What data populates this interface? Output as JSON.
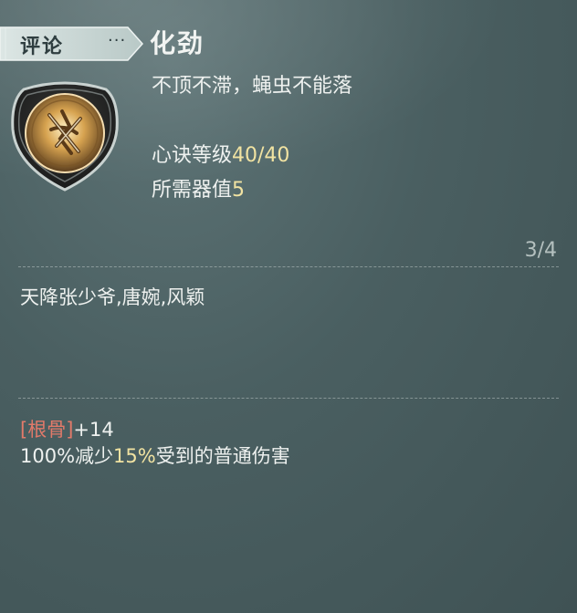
{
  "tab": {
    "review_label": "评论",
    "more_label": "···"
  },
  "skill": {
    "name": "化劲",
    "description": "不顶不滞，蝇虫不能落",
    "level_label": "心诀等级",
    "level_value": "40/40",
    "cost_label": "所需器值",
    "cost_value": "5"
  },
  "pagination": "3/4",
  "members": "天降张少爷,唐婉,风颖",
  "attribute": {
    "name": "[根骨]",
    "bonus": "+14"
  },
  "effect": {
    "prefix": "100%减少",
    "highlight": "15%",
    "suffix": "受到的普通伤害"
  },
  "colors": {
    "background": "#4a5f61",
    "highlight": "#f1e3a2",
    "attribute": "#e27a6a",
    "tab": "#c9d6d4"
  },
  "icons": {
    "emblem": "skill-emblem-icon"
  }
}
